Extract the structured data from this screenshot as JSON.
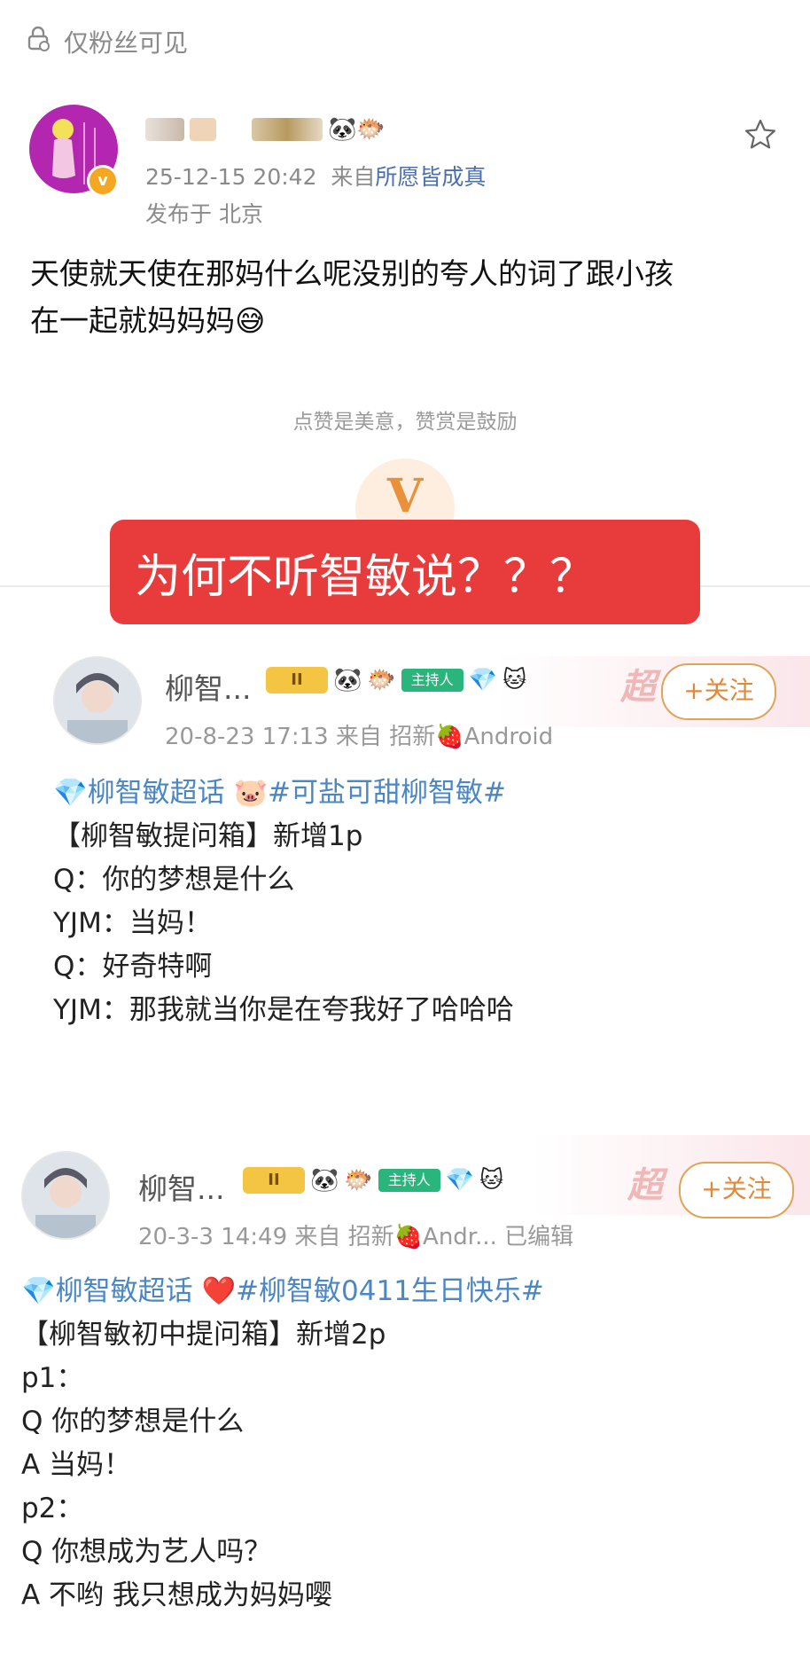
{
  "topbar": {
    "visibility_text": "仅粉丝可见"
  },
  "post": {
    "name_emoji": "🐼🐡",
    "timestamp": "25-12-15 20:42",
    "from_label": "来自",
    "source": "所愿皆成真",
    "location": "发布于 北京",
    "content_lines": [
      "天使就天使在那妈什么呢没别的夸人的词了跟小孩",
      "在一起就妈妈妈😅"
    ],
    "tip": "点赞是美意，赞赏是鼓励",
    "reward_glyph": "V",
    "avatar_badge": "v"
  },
  "overlay_caption": "为何不听智敏说？？？",
  "screenshot1": {
    "name": "柳智...",
    "crown_badge": "II",
    "host_badge": "主持人",
    "chao": "超",
    "follow_label": "+关注",
    "meta": "20-8-23 17:13  来自 招新🍓Android",
    "topic_line": "💎柳智敏超话 🐷#可盐可甜柳智敏#",
    "lines": [
      "【柳智敏提问箱】新增1p",
      "Q：你的梦想是什么",
      "YJM：当妈！",
      "Q：好奇特啊",
      "YJM：那我就当你是在夸我好了哈哈哈"
    ]
  },
  "screenshot2": {
    "name": "柳智...",
    "crown_badge": "II",
    "host_badge": "主持人",
    "chao": "超",
    "follow_label": "+关注",
    "meta": "20-3-3 14:49  来自 招新🍓Andr...  已编辑",
    "topic_line": "💎柳智敏超话 ❤️#柳智敏0411生日快乐#",
    "lines": [
      "【柳智敏初中提问箱】新增2p",
      "p1：",
      "Q  你的梦想是什么",
      "A  当妈！",
      "p2：",
      "Q  你想成为艺人吗？",
      "A  不哟 我只想成为妈妈嘤"
    ]
  }
}
